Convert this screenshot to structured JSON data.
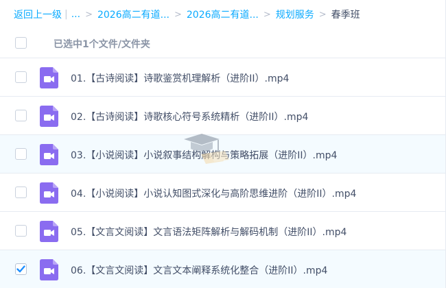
{
  "breadcrumb": {
    "back": "返回上一级",
    "ellipsis": "...",
    "items": [
      "2026高二有道...",
      "2026高二有道...",
      "规划服务"
    ],
    "current": "春季班"
  },
  "header": {
    "selected_text": "已选中1个文件/文件夹"
  },
  "files": [
    {
      "name": "01.【古诗阅读】诗歌鉴赏机理解析（进阶II）.mp4",
      "checked": false
    },
    {
      "name": "02.【古诗阅读】诗歌核心符号系统精析（进阶II）.mp4",
      "checked": false
    },
    {
      "name": "03.【小说阅读】小说叙事结构解构与策略拓展（进阶II）.mp4",
      "checked": false
    },
    {
      "name": "04.【小说阅读】小说认知图式深化与高阶思维进阶（进阶II）.mp4",
      "checked": false
    },
    {
      "name": "05.【文言文阅读】文言语法矩阵解析与解码机制（进阶II）.mp4",
      "checked": false
    },
    {
      "name": "06.【文言文阅读】文言文本阐释系统化整合（进阶II）.mp4",
      "checked": true
    }
  ],
  "icons": {
    "file_type": "video-file-icon",
    "check": "checkmark-icon"
  },
  "colors": {
    "link": "#09aaff",
    "video_icon": "#8a6cf0",
    "check": "#1d8fff",
    "row_highlight": "#f4fbff"
  }
}
